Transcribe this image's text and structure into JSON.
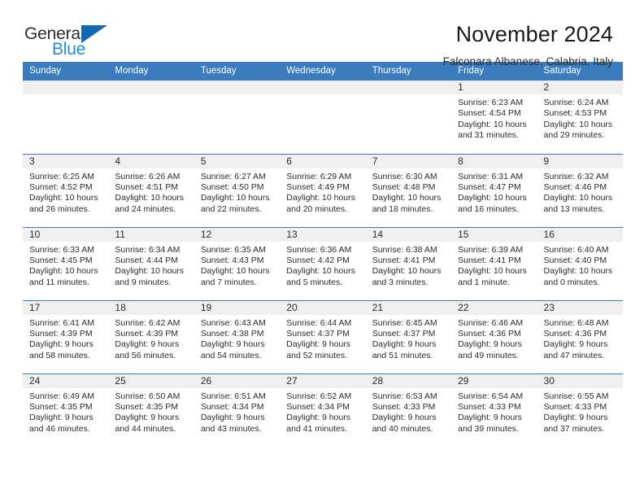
{
  "logo": {
    "line1": "General",
    "line2": "Blue",
    "triangle_color": "#1268b3",
    "line2_color": "#1e8bd4"
  },
  "header": {
    "title": "November 2024",
    "subtitle": "Falconara Albanese, Calabria, Italy"
  },
  "theme": {
    "header_blue": "#3a7cbe",
    "daynum_gray": "#efefef",
    "text": "#2b2b2b"
  },
  "calendar": {
    "weekday_headers": [
      "Sunday",
      "Monday",
      "Tuesday",
      "Wednesday",
      "Thursday",
      "Friday",
      "Saturday"
    ],
    "weeks": [
      [
        {
          "day": "",
          "sunrise": "",
          "sunset": "",
          "daylight": ""
        },
        {
          "day": "",
          "sunrise": "",
          "sunset": "",
          "daylight": ""
        },
        {
          "day": "",
          "sunrise": "",
          "sunset": "",
          "daylight": ""
        },
        {
          "day": "",
          "sunrise": "",
          "sunset": "",
          "daylight": ""
        },
        {
          "day": "",
          "sunrise": "",
          "sunset": "",
          "daylight": ""
        },
        {
          "day": "1",
          "sunrise": "Sunrise: 6:23 AM",
          "sunset": "Sunset: 4:54 PM",
          "daylight": "Daylight: 10 hours and 31 minutes."
        },
        {
          "day": "2",
          "sunrise": "Sunrise: 6:24 AM",
          "sunset": "Sunset: 4:53 PM",
          "daylight": "Daylight: 10 hours and 29 minutes."
        }
      ],
      [
        {
          "day": "3",
          "sunrise": "Sunrise: 6:25 AM",
          "sunset": "Sunset: 4:52 PM",
          "daylight": "Daylight: 10 hours and 26 minutes."
        },
        {
          "day": "4",
          "sunrise": "Sunrise: 6:26 AM",
          "sunset": "Sunset: 4:51 PM",
          "daylight": "Daylight: 10 hours and 24 minutes."
        },
        {
          "day": "5",
          "sunrise": "Sunrise: 6:27 AM",
          "sunset": "Sunset: 4:50 PM",
          "daylight": "Daylight: 10 hours and 22 minutes."
        },
        {
          "day": "6",
          "sunrise": "Sunrise: 6:29 AM",
          "sunset": "Sunset: 4:49 PM",
          "daylight": "Daylight: 10 hours and 20 minutes."
        },
        {
          "day": "7",
          "sunrise": "Sunrise: 6:30 AM",
          "sunset": "Sunset: 4:48 PM",
          "daylight": "Daylight: 10 hours and 18 minutes."
        },
        {
          "day": "8",
          "sunrise": "Sunrise: 6:31 AM",
          "sunset": "Sunset: 4:47 PM",
          "daylight": "Daylight: 10 hours and 16 minutes."
        },
        {
          "day": "9",
          "sunrise": "Sunrise: 6:32 AM",
          "sunset": "Sunset: 4:46 PM",
          "daylight": "Daylight: 10 hours and 13 minutes."
        }
      ],
      [
        {
          "day": "10",
          "sunrise": "Sunrise: 6:33 AM",
          "sunset": "Sunset: 4:45 PM",
          "daylight": "Daylight: 10 hours and 11 minutes."
        },
        {
          "day": "11",
          "sunrise": "Sunrise: 6:34 AM",
          "sunset": "Sunset: 4:44 PM",
          "daylight": "Daylight: 10 hours and 9 minutes."
        },
        {
          "day": "12",
          "sunrise": "Sunrise: 6:35 AM",
          "sunset": "Sunset: 4:43 PM",
          "daylight": "Daylight: 10 hours and 7 minutes."
        },
        {
          "day": "13",
          "sunrise": "Sunrise: 6:36 AM",
          "sunset": "Sunset: 4:42 PM",
          "daylight": "Daylight: 10 hours and 5 minutes."
        },
        {
          "day": "14",
          "sunrise": "Sunrise: 6:38 AM",
          "sunset": "Sunset: 4:41 PM",
          "daylight": "Daylight: 10 hours and 3 minutes."
        },
        {
          "day": "15",
          "sunrise": "Sunrise: 6:39 AM",
          "sunset": "Sunset: 4:41 PM",
          "daylight": "Daylight: 10 hours and 1 minute."
        },
        {
          "day": "16",
          "sunrise": "Sunrise: 6:40 AM",
          "sunset": "Sunset: 4:40 PM",
          "daylight": "Daylight: 10 hours and 0 minutes."
        }
      ],
      [
        {
          "day": "17",
          "sunrise": "Sunrise: 6:41 AM",
          "sunset": "Sunset: 4:39 PM",
          "daylight": "Daylight: 9 hours and 58 minutes."
        },
        {
          "day": "18",
          "sunrise": "Sunrise: 6:42 AM",
          "sunset": "Sunset: 4:39 PM",
          "daylight": "Daylight: 9 hours and 56 minutes."
        },
        {
          "day": "19",
          "sunrise": "Sunrise: 6:43 AM",
          "sunset": "Sunset: 4:38 PM",
          "daylight": "Daylight: 9 hours and 54 minutes."
        },
        {
          "day": "20",
          "sunrise": "Sunrise: 6:44 AM",
          "sunset": "Sunset: 4:37 PM",
          "daylight": "Daylight: 9 hours and 52 minutes."
        },
        {
          "day": "21",
          "sunrise": "Sunrise: 6:45 AM",
          "sunset": "Sunset: 4:37 PM",
          "daylight": "Daylight: 9 hours and 51 minutes."
        },
        {
          "day": "22",
          "sunrise": "Sunrise: 6:46 AM",
          "sunset": "Sunset: 4:36 PM",
          "daylight": "Daylight: 9 hours and 49 minutes."
        },
        {
          "day": "23",
          "sunrise": "Sunrise: 6:48 AM",
          "sunset": "Sunset: 4:36 PM",
          "daylight": "Daylight: 9 hours and 47 minutes."
        }
      ],
      [
        {
          "day": "24",
          "sunrise": "Sunrise: 6:49 AM",
          "sunset": "Sunset: 4:35 PM",
          "daylight": "Daylight: 9 hours and 46 minutes."
        },
        {
          "day": "25",
          "sunrise": "Sunrise: 6:50 AM",
          "sunset": "Sunset: 4:35 PM",
          "daylight": "Daylight: 9 hours and 44 minutes."
        },
        {
          "day": "26",
          "sunrise": "Sunrise: 6:51 AM",
          "sunset": "Sunset: 4:34 PM",
          "daylight": "Daylight: 9 hours and 43 minutes."
        },
        {
          "day": "27",
          "sunrise": "Sunrise: 6:52 AM",
          "sunset": "Sunset: 4:34 PM",
          "daylight": "Daylight: 9 hours and 41 minutes."
        },
        {
          "day": "28",
          "sunrise": "Sunrise: 6:53 AM",
          "sunset": "Sunset: 4:33 PM",
          "daylight": "Daylight: 9 hours and 40 minutes."
        },
        {
          "day": "29",
          "sunrise": "Sunrise: 6:54 AM",
          "sunset": "Sunset: 4:33 PM",
          "daylight": "Daylight: 9 hours and 39 minutes."
        },
        {
          "day": "30",
          "sunrise": "Sunrise: 6:55 AM",
          "sunset": "Sunset: 4:33 PM",
          "daylight": "Daylight: 9 hours and 37 minutes."
        }
      ]
    ]
  }
}
